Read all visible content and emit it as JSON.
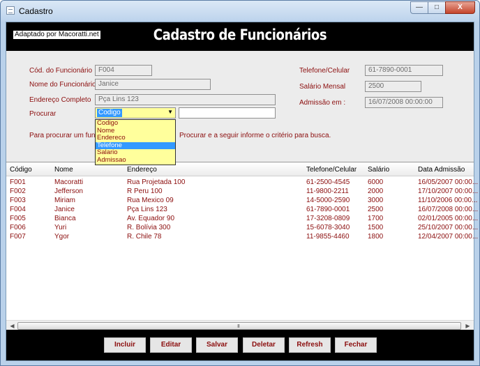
{
  "window": {
    "title": "Cadastro",
    "controls": [
      "—",
      "□",
      "X"
    ]
  },
  "header": {
    "badge": "Adaptado por Macoratti.net",
    "title": "Cadastro de Funcionários"
  },
  "form": {
    "cod_label": "Cód. do Funcionário",
    "cod_value": "F004",
    "nome_label": "Nome do Funcionário",
    "nome_value": "Janice",
    "endereco_label": "Endereço Completo",
    "endereco_value": "Pça Lins 123",
    "procurar_label": "Procurar",
    "procurar_selected": "Codigo",
    "procurar_text": "",
    "telefone_label": "Telefone/Celular",
    "telefone_value": "61-7890-0001",
    "salario_label": "Salário Mensal",
    "salario_value": "2500",
    "admissao_label": "Admissão em :",
    "admissao_value": "16/07/2008 00:00:00",
    "hint_left": "Para procurar um funcion",
    "hint_right": "Procurar e a seguir informe o critério para busca."
  },
  "dropdown": {
    "options": [
      "Codigo",
      "Nome",
      "Endereco",
      "Telefone",
      "Salario",
      "Admissao"
    ],
    "highlighted": "Telefone"
  },
  "grid": {
    "columns": [
      "Código",
      "Nome",
      "Endereço",
      "Telefone/Celular",
      "Salário",
      "Data Admissão"
    ],
    "rows": [
      [
        "F001",
        "Macoratti",
        "Rua Projetada 100",
        "61-2500-4545",
        "6000",
        "16/05/2007 00:00..."
      ],
      [
        "F002",
        "Jefferson",
        "R Peru 100",
        "11-9800-2211",
        "2000",
        "17/10/2007 00:00..."
      ],
      [
        "F003",
        "Miriam",
        "Rua Mexico 09",
        "14-5000-2590",
        "3000",
        "11/10/2006 00:00..."
      ],
      [
        "F004",
        "Janice",
        "Pça Lins 123",
        "61-7890-0001",
        "2500",
        "16/07/2008 00:00..."
      ],
      [
        "F005",
        "Bianca",
        "Av. Equador 90",
        "17-3208-0809",
        "1700",
        "02/01/2005 00:00..."
      ],
      [
        "F006",
        "Yuri",
        "R. Bolívia 300",
        "15-6078-3040",
        "1500",
        "25/10/2007 00:00..."
      ],
      [
        "F007",
        "Ygor",
        "R. Chile 78",
        "11-9855-4460",
        "1800",
        "12/04/2007 00:00..."
      ]
    ]
  },
  "buttons": {
    "incluir": "Incluir",
    "editar": "Editar",
    "salvar": "Salvar",
    "deletar": "Deletar",
    "refresh": "Refresh",
    "fechar": "Fechar"
  },
  "colors": {
    "label_text": "#8b0d0d",
    "header_bg": "#000000",
    "combo_bg": "#ffff9c",
    "selection": "#3399ff"
  }
}
